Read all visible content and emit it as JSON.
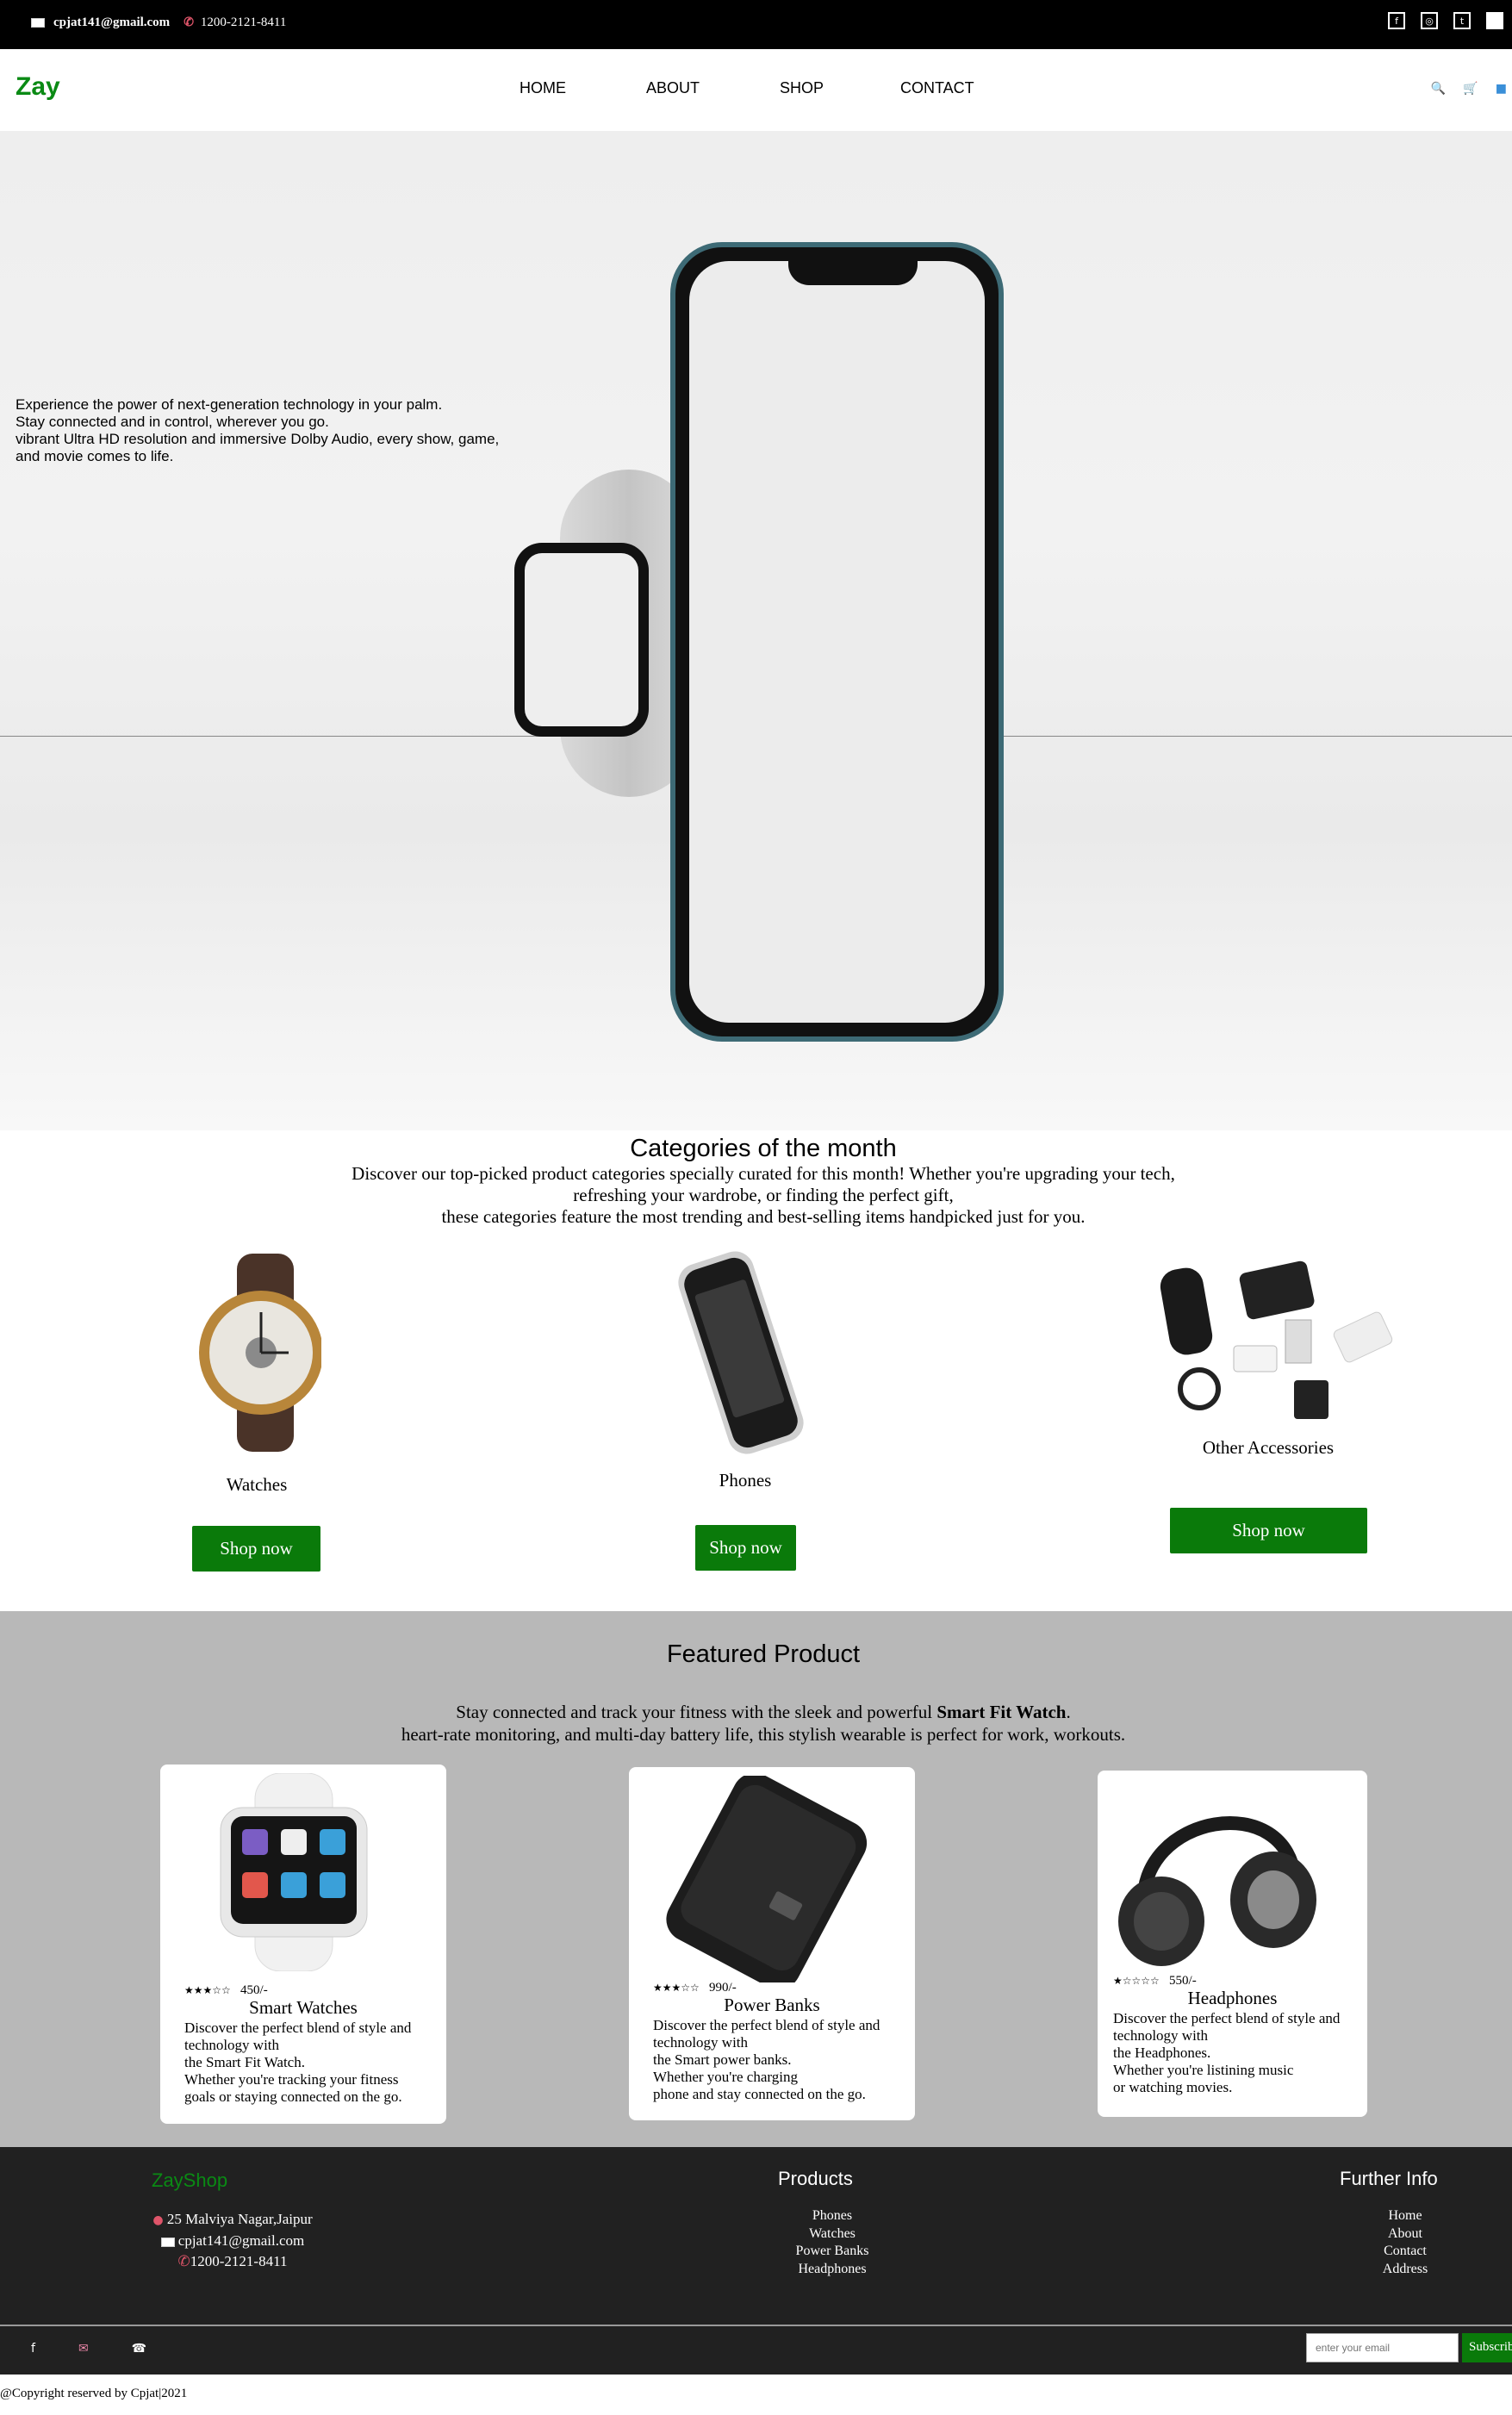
{
  "topbar": {
    "email": "cpjat141@gmail.com",
    "phone": "1200-2121-8411",
    "social_icons": [
      "facebook-icon",
      "instagram-icon",
      "twitter-icon",
      "linkedin-icon"
    ]
  },
  "nav": {
    "brand": "Zay",
    "links": [
      "HOME",
      "ABOUT",
      "SHOP",
      "CONTACT"
    ],
    "icons": [
      "search-icon",
      "cart-icon",
      "user-icon"
    ]
  },
  "hero": {
    "lines": [
      "Experience the power of next-generation technology in your palm.",
      "Stay connected and in control, wherever you go.",
      "vibrant Ultra HD resolution and immersive Dolby Audio, every show, game,",
      "and movie comes to life."
    ]
  },
  "categories": {
    "title": "Categories of the month",
    "desc": [
      "Discover our top-picked product categories specially curated for this month! Whether you're upgrading your tech,",
      "refreshing your wardrobe, or finding the perfect gift,",
      "these categories feature the most trending and best-selling items handpicked just for you."
    ],
    "items": [
      {
        "name": "Watches",
        "button": "Shop now"
      },
      {
        "name": "Phones",
        "button": "Shop now"
      },
      {
        "name": "Other Accessories",
        "button": "Shop now"
      }
    ]
  },
  "featured": {
    "title": "Featured Product",
    "desc_prefix": "Stay connected and track your fitness with the sleek and powerful ",
    "desc_bold": "Smart Fit Watch",
    "desc_suffix": ".",
    "desc_line2": "heart-rate monitoring, and multi-day battery life, this stylish wearable is perfect for work, workouts.",
    "products": [
      {
        "stars": "★★★☆☆",
        "rating": 3,
        "price": "450/-",
        "name": "Smart Watches",
        "lines": [
          "Discover the perfect blend of style and",
          "technology with",
          "the Smart Fit Watch.",
          "Whether you're tracking your fitness",
          "goals or staying connected on the go."
        ]
      },
      {
        "stars": "★★★☆☆",
        "rating": 3,
        "price": "990/-",
        "name": "Power Banks",
        "lines": [
          "Discover the perfect blend of style and",
          "technology with",
          "the Smart power banks.",
          "Whether you're charging",
          "phone and stay connected on the go."
        ]
      },
      {
        "stars": "★☆☆☆☆",
        "rating": 1,
        "price": "550/-",
        "name": "Headphones",
        "lines": [
          "Discover the perfect blend of style and",
          "technology with",
          "the Headphones.",
          "Whether you're listining music",
          "or watching movies."
        ]
      }
    ]
  },
  "footer": {
    "brand": "ZayShop",
    "address": "25 Malviya Nagar,Jaipur",
    "email": "cpjat141@gmail.com",
    "phone": "1200-2121-8411",
    "products_title": "Products",
    "products": [
      "Phones",
      "Watches",
      "Power Banks",
      "Headphones"
    ],
    "info_title": "Further Info",
    "info": [
      "Home",
      "About",
      "Contact",
      "Address"
    ],
    "social_icons": [
      "facebook-icon",
      "mail-icon",
      "phone-icon"
    ],
    "subscribe_placeholder": "enter your email",
    "subscribe_button": "Subscribe",
    "copyright": "@Copyright reserved by Cpjat|2021"
  },
  "colors": {
    "brand_green": "#0a8a14",
    "button_green": "#0a7a0a",
    "footer_bg": "#212121",
    "featured_bg": "#b8b8b8"
  }
}
